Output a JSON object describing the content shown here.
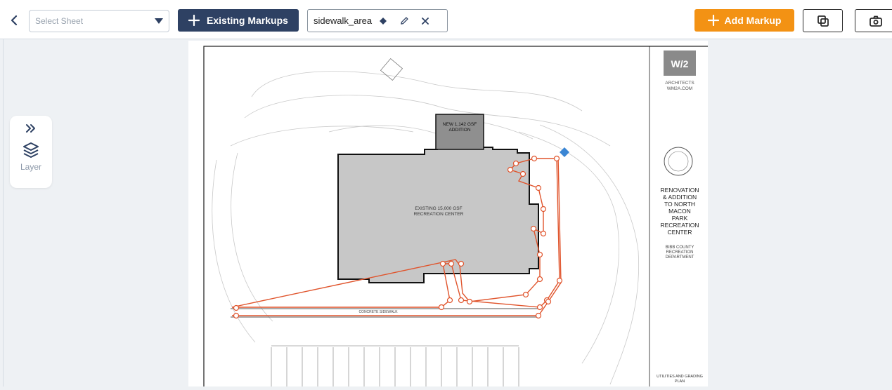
{
  "toolbar": {
    "sheet_select_placeholder": "Select Sheet",
    "existing_markups_label": "Existing Markups",
    "markup_chip_label": "sidewalk_area",
    "add_markup_label": "Add Markup"
  },
  "layer_panel": {
    "label": "Layer"
  },
  "sheet": {
    "title_lines": [
      "RENOVATION",
      "& ADDITION",
      "TO NORTH",
      "MACON",
      "PARK",
      "RECREATION",
      "CENTER"
    ],
    "owner_lines": [
      "BIBB COUNTY",
      "RECREATION",
      "DEPARTMENT"
    ],
    "firm_name": "ARCHITECTS",
    "firm_url": "WM2A.COM",
    "addition_label_1": "NEW 1,142 GSF",
    "addition_label_2": "ADDITION",
    "existing_center_label_1": "EXISTING 15,000 GSF",
    "existing_center_label_2": "RECREATION CENTER",
    "sidewalk_label": "CONCRETE SIDEWALK",
    "plan_title_1": "UTILITIES AND GRADING",
    "plan_title_2": "PLAN"
  },
  "colors": {
    "navy": "#2e4163",
    "orange": "#f39214",
    "markup": "#e0542c",
    "diamond": "#3b86d4"
  }
}
